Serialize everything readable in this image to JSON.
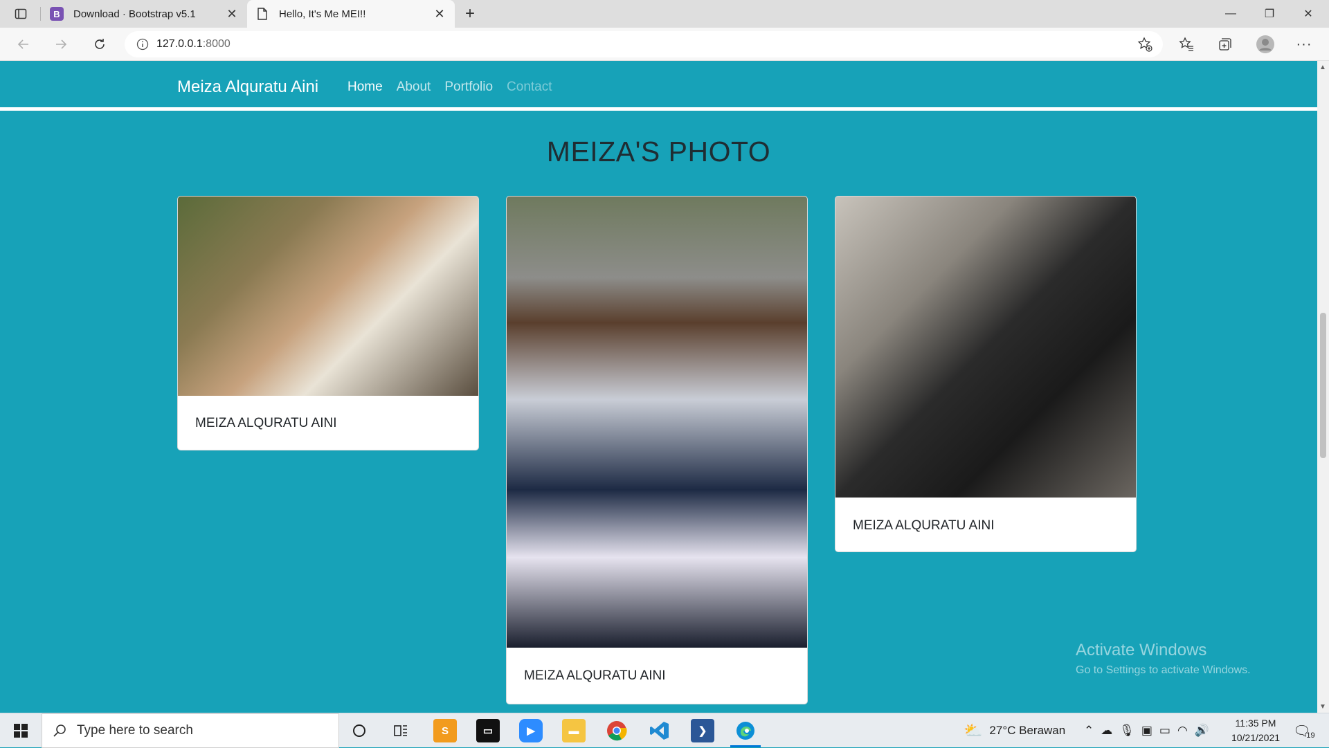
{
  "browser": {
    "tabs": [
      {
        "title": "Download · Bootstrap v5.1",
        "favicon": "B",
        "active": false
      },
      {
        "title": "Hello, It's Me MEI!!",
        "active": true
      }
    ],
    "url_host": "127.0.0.1",
    "url_port": ":8000"
  },
  "site": {
    "brand": "Meiza Alquratu Aini",
    "nav": [
      "Home",
      "About",
      "Portfolio",
      "Contact"
    ],
    "section_title": "MEIZA'S PHOTO",
    "cards": [
      {
        "caption": "MEIZA ALQURATU AINI"
      },
      {
        "caption": "MEIZA ALQURATU AINI"
      },
      {
        "caption": "MEIZA ALQURATU AINI"
      }
    ]
  },
  "watermark": {
    "line1": "Activate Windows",
    "line2": "Go to Settings to activate Windows."
  },
  "taskbar": {
    "search_placeholder": "Type here to search",
    "weather": "27°C  Berawan",
    "time": "11:35 PM",
    "date": "10/21/2021",
    "notification_count": "19"
  },
  "colors": {
    "page_background": "#17a2b8",
    "card_background": "#ffffff",
    "title_color": "#1f2d33"
  }
}
